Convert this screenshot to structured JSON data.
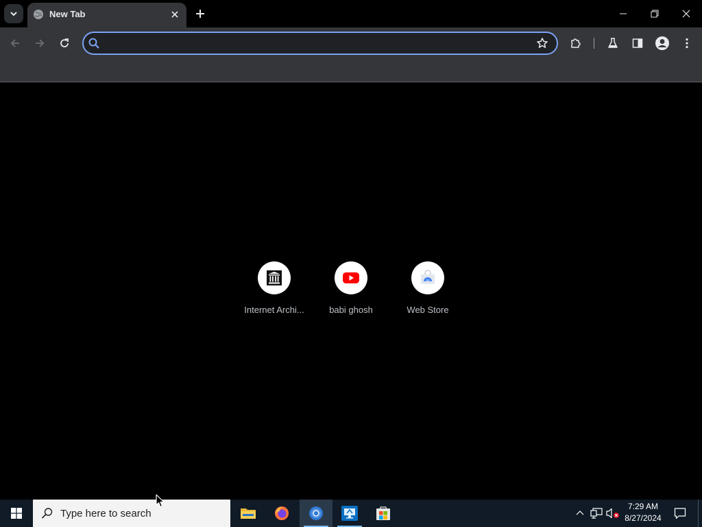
{
  "browser": {
    "tab": {
      "title": "New Tab"
    },
    "omnibox": {
      "value": "",
      "placeholder": ""
    },
    "icons": {
      "tab_search": "chevron-down-icon",
      "tab_close": "close-icon",
      "new_tab": "plus-icon",
      "minimize": "minimize-icon",
      "restore": "restore-icon",
      "close_window": "close-icon",
      "back": "arrow-left-icon",
      "forward": "arrow-right-icon",
      "reload": "reload-icon",
      "bookmark": "star-icon",
      "extensions": "puzzle-icon",
      "labs": "flask-icon",
      "side_panel": "side-panel-icon",
      "profile": "profile-icon",
      "menu": "kebab-menu-icon"
    },
    "accent": "#7ca3f5"
  },
  "new_tab_page": {
    "shortcuts": [
      {
        "label": "Internet Archi...",
        "icon": "internet-archive-icon"
      },
      {
        "label": "babi ghosh",
        "icon": "youtube-icon"
      },
      {
        "label": "Web Store",
        "icon": "web-store-icon"
      }
    ]
  },
  "taskbar": {
    "search_placeholder": "Type here to search",
    "apps": [
      {
        "name": "File Explorer",
        "icon": "folder-icon"
      },
      {
        "name": "Firefox",
        "icon": "firefox-icon"
      },
      {
        "name": "Chrome",
        "icon": "chrome-icon",
        "active": true
      },
      {
        "name": "Remote Desktop",
        "icon": "remote-desktop-icon"
      },
      {
        "name": "Microsoft Store",
        "icon": "store-icon"
      }
    ],
    "clock": {
      "time": "7:29 AM",
      "date": "8/27/2024"
    }
  }
}
